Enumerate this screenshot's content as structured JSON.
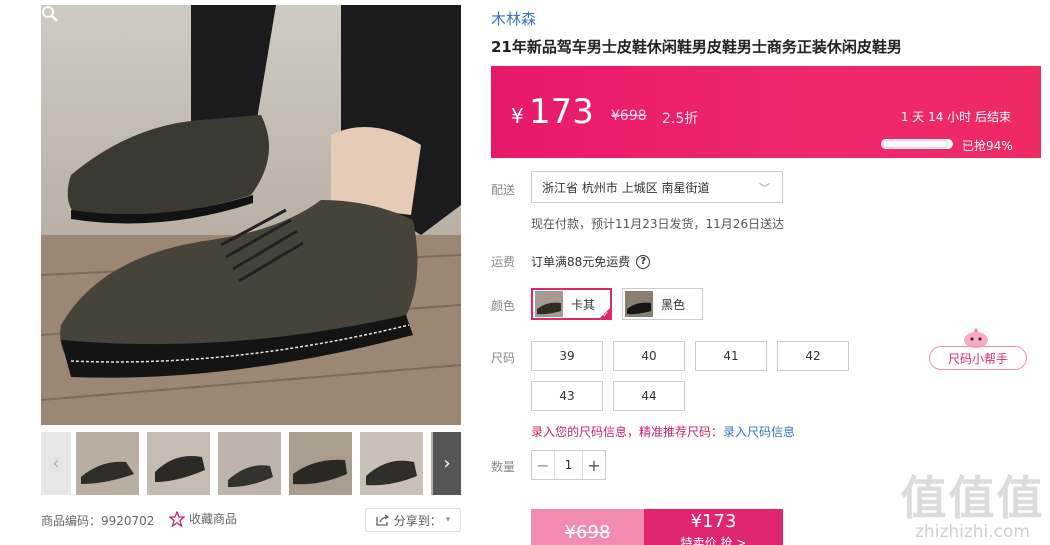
{
  "product": {
    "brand": "木林森",
    "title": "21年新品驾车男士皮鞋休闲鞋男皮鞋男士商务正装休闲皮鞋男",
    "code_label": "商品编码：9920702",
    "favorite_label": "收藏商品",
    "share_label": "分享到："
  },
  "price_bar": {
    "currency": "¥",
    "price": "173",
    "original_price": "¥698",
    "discount": "2.5折",
    "countdown": "1 天 14 小时 后结束",
    "sold_label": "已抢94%",
    "sold_percent": 94
  },
  "shipping": {
    "label": "配送",
    "address": "浙江省 杭州市 上城区 南星街道",
    "delivery_note": "现在付款，预计11月23日发货，11月26日送达",
    "freight_label": "运费",
    "freight_note": "订单满88元免运费"
  },
  "color": {
    "label": "颜色",
    "options": [
      {
        "name": "卡其",
        "selected": true
      },
      {
        "name": "黑色",
        "selected": false
      }
    ]
  },
  "size": {
    "label": "尺码",
    "options": [
      "39",
      "40",
      "41",
      "42",
      "43",
      "44"
    ],
    "helper": "尺码小帮手",
    "tip_prefix": "录入您的尺码信息，精准推荐尺码：",
    "tip_link": "录入尺码信息"
  },
  "quantity": {
    "label": "数量",
    "value": "1",
    "minus": "−",
    "plus": "+"
  },
  "buy": {
    "original_price": "¥698",
    "price": "¥173",
    "caption": "特卖价 抢 >"
  },
  "watermark": {
    "big": "值值值",
    "small": "zhizhizhi.com"
  },
  "icons": {
    "zoom": "magnifier-icon",
    "favorite": "star-icon",
    "share": "share-icon",
    "help": "question-icon",
    "thumb_prev": "chevron-left-icon",
    "thumb_next": "chevron-right-icon"
  }
}
